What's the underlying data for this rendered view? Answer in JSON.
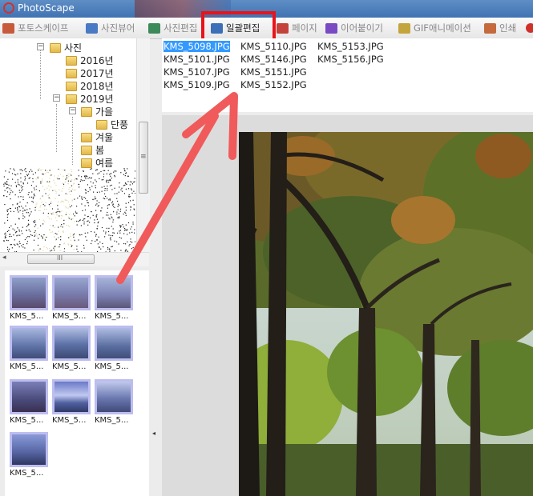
{
  "window": {
    "title": "PhotoScape"
  },
  "menu": {
    "tabs": [
      {
        "label": "포토스케이프",
        "icon": "photoscape-icon",
        "color": "#c85a3c"
      },
      {
        "label": "사진뷰어",
        "icon": "viewer-icon",
        "color": "#4a7ac4"
      },
      {
        "label": "사진편집",
        "icon": "editor-icon",
        "color": "#3c8a5a"
      },
      {
        "label": "일괄편집",
        "icon": "batch-editor-icon",
        "color": "#3c6fb8",
        "active": true
      },
      {
        "label": "페이지",
        "icon": "page-icon",
        "color": "#c4423c"
      },
      {
        "label": "이어붙이기",
        "icon": "combine-icon",
        "color": "#7a4ac4"
      },
      {
        "label": "GIF애니메이션",
        "icon": "gif-icon",
        "color": "#c4a43c"
      },
      {
        "label": "인쇄",
        "icon": "print-icon",
        "color": "#c46a3c"
      }
    ]
  },
  "tree": {
    "nodes": [
      {
        "label": "사진",
        "toggle": "−"
      },
      {
        "label": "2016년"
      },
      {
        "label": "2017년"
      },
      {
        "label": "2018년"
      },
      {
        "label": "2019년",
        "toggle": "−"
      },
      {
        "label": "가을",
        "toggle": "−"
      },
      {
        "label": "단풍"
      },
      {
        "label": "겨울"
      },
      {
        "label": "봄"
      },
      {
        "label": "여름"
      }
    ],
    "hscroll_grip": "III",
    "vscroll_grip": "≡"
  },
  "thumbnails": [
    {
      "caption": "KMS_5..."
    },
    {
      "caption": "KMS_5..."
    },
    {
      "caption": "KMS_5..."
    },
    {
      "caption": "KMS_5..."
    },
    {
      "caption": "KMS_5..."
    },
    {
      "caption": "KMS_5..."
    },
    {
      "caption": "KMS_5..."
    },
    {
      "caption": "KMS_5..."
    },
    {
      "caption": "KMS_5..."
    },
    {
      "caption": "KMS_5..."
    }
  ],
  "files": {
    "selected": "KMS_5098.JPG",
    "items": [
      "KMS_5098.JPG",
      "KMS_5101.JPG",
      "KMS_5107.JPG",
      "KMS_5109.JPG",
      "KMS_5110.JPG",
      "KMS_5146.JPG",
      "KMS_5151.JPG",
      "KMS_5152.JPG",
      "KMS_5153.JPG",
      "KMS_5156.JPG"
    ]
  },
  "annotation": {
    "highlight_color": "#e8141c",
    "arrow_color": "#f05a5a"
  },
  "splitter": {
    "arrow": "◂"
  }
}
